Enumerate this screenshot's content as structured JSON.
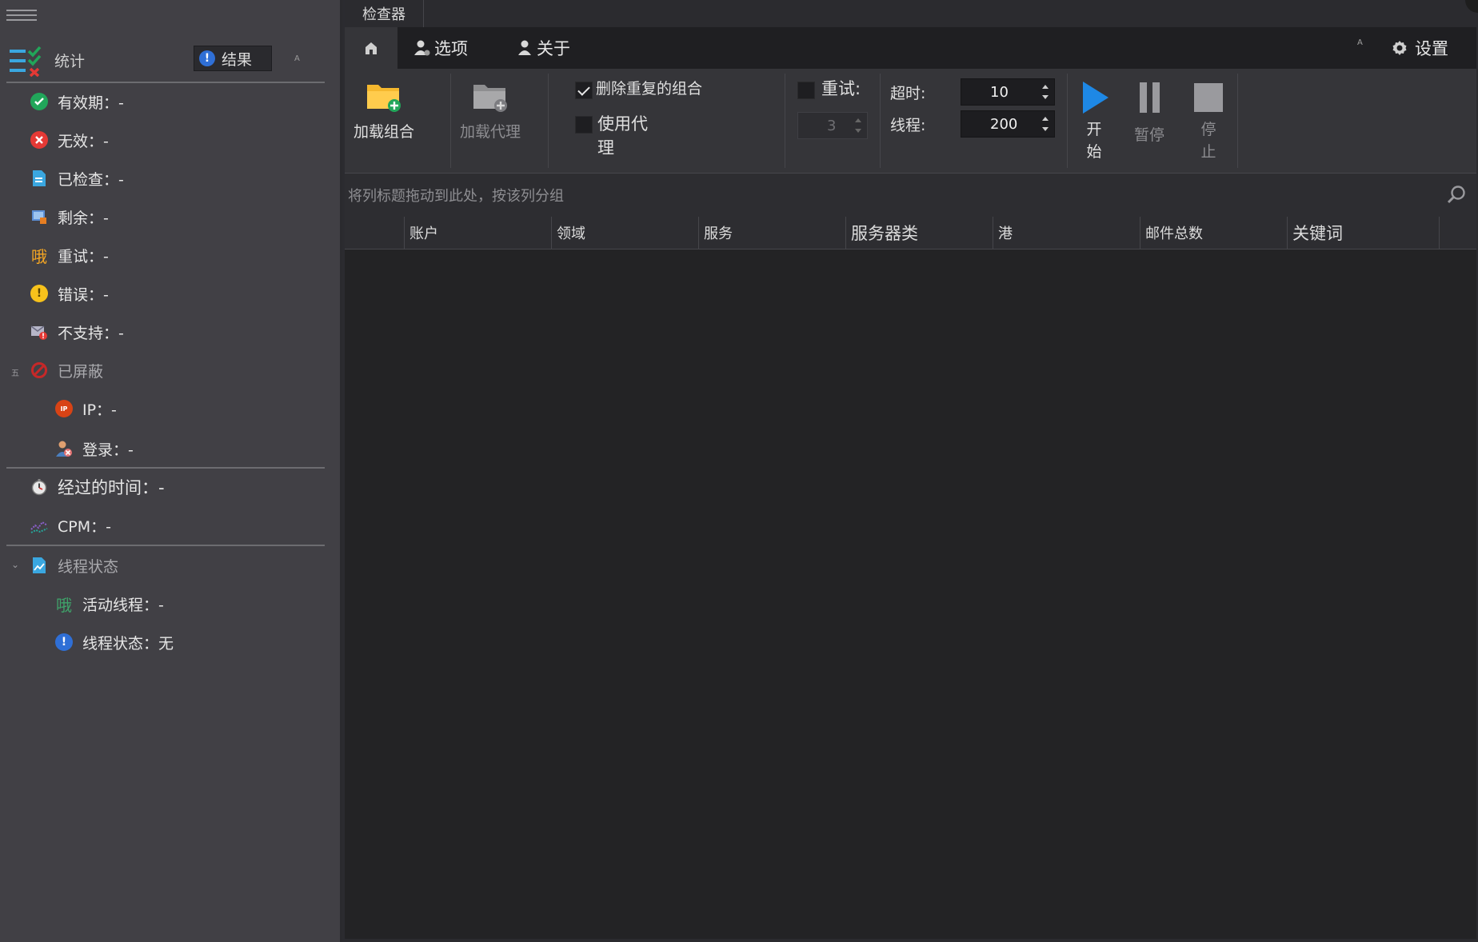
{
  "sidebar": {
    "stats_label": "统计",
    "results_button": "结果",
    "tiny_label": "A",
    "items": [
      {
        "label": "有效期：-",
        "icon": "check-circle-icon",
        "color": "#21a65a"
      },
      {
        "label": "无效：-",
        "icon": "x-circle-icon",
        "color": "#e53935"
      },
      {
        "label": "已检查：-",
        "icon": "document-icon",
        "color": "#3aa7e0"
      },
      {
        "label": "剩余：-",
        "icon": "monitor-icon",
        "color": "#5b8fd6"
      },
      {
        "label": "重试：-",
        "icon": "retry-glyph-icon",
        "glyph": "哦",
        "color": "#f5a623"
      },
      {
        "label": "错误：-",
        "icon": "warning-icon",
        "color": "#f7c21b"
      },
      {
        "label": "不支持：-",
        "icon": "mail-alert-icon",
        "color": "#9a9ab0"
      },
      {
        "label": "已屏蔽",
        "icon": "blocked-icon",
        "color": "#c62828"
      },
      {
        "label": "IP：-",
        "icon": "ip-shield-icon",
        "badge": "IP",
        "color": "#d84315"
      },
      {
        "label": "登录：-",
        "icon": "user-blocked-icon",
        "color": "#e0a070"
      },
      {
        "label": "经过的时间：-",
        "icon": "stopwatch-icon",
        "color": "#cfcfcf"
      },
      {
        "label": "CPM：-",
        "icon": "chart-line-icon",
        "color": "#8a5fc9"
      },
      {
        "label": "线程状态",
        "icon": "thread-chart-icon",
        "color": "#3aa7e0"
      },
      {
        "label": "活动线程：-",
        "icon": "active-thread-glyph-icon",
        "glyph": "哦",
        "color": "#3fa36a"
      },
      {
        "label": "线程状态：无",
        "icon": "info-icon",
        "color": "#2f6fd6"
      }
    ],
    "blocked_prefix": "五"
  },
  "main": {
    "doc_tab": "检查器",
    "tabs": {
      "options": "选项",
      "about": "关于",
      "settings": "设置",
      "tiny": "A"
    },
    "ribbon": {
      "load_combo": "加载组合",
      "load_proxy": "加载代理",
      "remove_duplicates": "删除重复的组合",
      "remove_duplicates_checked": true,
      "use_proxy_line1": "使用代",
      "use_proxy_line2": "理",
      "use_proxy_checked": false,
      "retry_label": "重试:",
      "retry_checked": false,
      "retry_value": "3",
      "timeout_label": "超时:",
      "timeout_value": "10",
      "threads_label": "线程:",
      "threads_value": "200",
      "start_line1": "开",
      "start_line2": "始",
      "pause": "暂停",
      "stop_line1": "停",
      "stop_line2": "止"
    },
    "group_hint": "将列标题拖动到此处，按该列分组",
    "columns": [
      "账户",
      "领域",
      "服务",
      "服务器类",
      "港",
      "邮件总数",
      "关键词"
    ]
  },
  "colors": {
    "accent_blue": "#1e88e5",
    "sidebar_bg": "#414045",
    "main_bg": "#2b2b2f",
    "grid_bg": "#232325"
  }
}
